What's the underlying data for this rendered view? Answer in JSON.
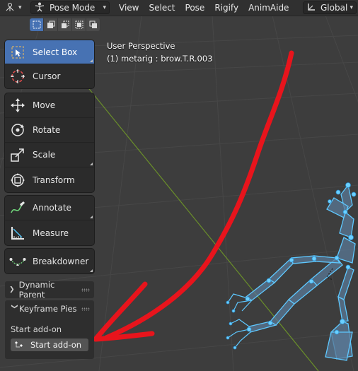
{
  "header": {
    "mode_label": "Pose Mode",
    "menus": [
      "View",
      "Select",
      "Pose",
      "Rigify",
      "AnimAide"
    ],
    "orientation_label": "Global"
  },
  "overlay": {
    "perspective": "User Perspective",
    "object_info": "(1) metarig : brow.T.R.003"
  },
  "toolbar": {
    "tools": [
      {
        "label": "Select Box",
        "icon": "select-box-icon",
        "active": true
      },
      {
        "label": "Cursor",
        "icon": "cursor-icon"
      },
      {
        "label": "Move",
        "icon": "move-icon"
      },
      {
        "label": "Rotate",
        "icon": "rotate-icon"
      },
      {
        "label": "Scale",
        "icon": "scale-icon"
      },
      {
        "label": "Transform",
        "icon": "transform-icon"
      },
      {
        "label": "Annotate",
        "icon": "annotate-icon"
      },
      {
        "label": "Measure",
        "icon": "measure-icon"
      },
      {
        "label": "Breakdowner",
        "icon": "breakdowner-icon"
      }
    ]
  },
  "panels": {
    "dynamic_parent": "Dynamic Parent",
    "keyframe_pies": "Keyframe Pies",
    "start_label": "Start add-on",
    "start_button": "Start add-on"
  },
  "colors": {
    "accent": "#4772b3",
    "rig_blue": "#4fc3f7",
    "annotation_red": "#e8141c"
  }
}
